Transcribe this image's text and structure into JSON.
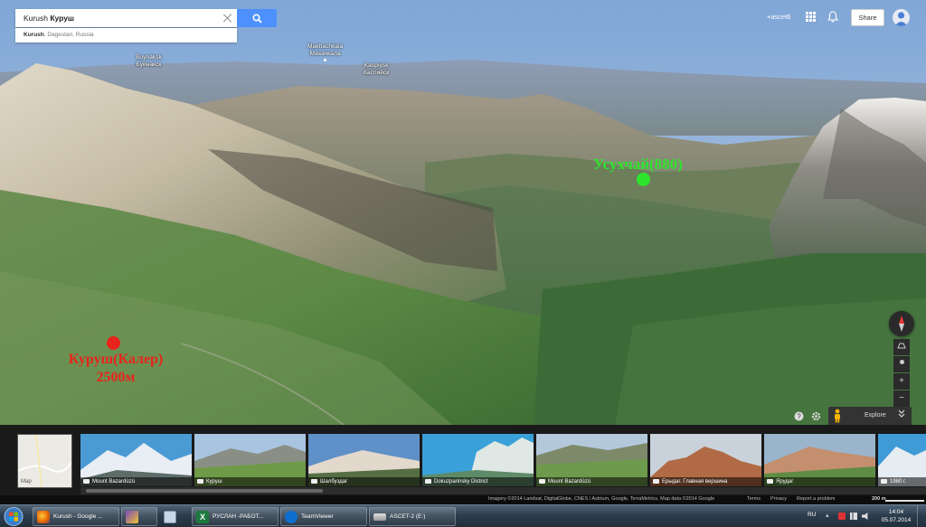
{
  "search": {
    "query_latin": "Kurush",
    "query_cyrillic": "Куруш",
    "suggestion_bold": "Kurush",
    "suggestion_rest": ", Dagestan, Russia"
  },
  "header": {
    "user": "+ascet6",
    "share_label": "Share"
  },
  "map_labels": {
    "buynaksk": {
      "name": "Buynaksk",
      "local": "Буйнакск"
    },
    "makhachkala": {
      "name": "Makhachkala",
      "local": "Махачкала"
    },
    "kaspiysk": {
      "name": "Kaspiysk",
      "local": "Каспийск"
    }
  },
  "places": {
    "usukhchay": {
      "label": "Усухчай(880)",
      "color": "#2ee52e"
    },
    "kurush": {
      "label_line1": "Куруш(Калер)",
      "label_line2": "2500м",
      "color": "#e8241c"
    }
  },
  "controls": {
    "explore_label": "Explore",
    "zoom_in": "+",
    "zoom_out": "−"
  },
  "strip": {
    "map_label": "Map",
    "thumbnails": [
      {
        "caption": "Mount Bazardüzü"
      },
      {
        "caption": "Куруш"
      },
      {
        "caption": "Шалбуздаг"
      },
      {
        "caption": "Dokuzparinsky District"
      },
      {
        "caption": "Mount Bazardüzü"
      },
      {
        "caption": "Ерыдаг. Главная вершина"
      },
      {
        "caption": "Ярудаг"
      },
      {
        "caption": "1980 г."
      }
    ]
  },
  "attribution": {
    "text": "Imagery ©2014 Landsat, DigitalGlobe, CNES / Astrium, Google, TerraMetrics, Map data ©2014 Google",
    "terms": "Terms",
    "privacy": "Privacy",
    "report": "Report a problem",
    "scale": "200 m"
  },
  "taskbar": {
    "items": [
      {
        "label": "Kurush - Google ..."
      },
      {
        "label": ""
      },
      {
        "label": ""
      },
      {
        "label": "РУСЛАН -РАБОТ..."
      },
      {
        "label": "TeamViewer"
      },
      {
        "label": "ASCET-2 (E:)"
      }
    ],
    "lang": "RU",
    "time": "14:04",
    "date": "05.07.2014"
  }
}
